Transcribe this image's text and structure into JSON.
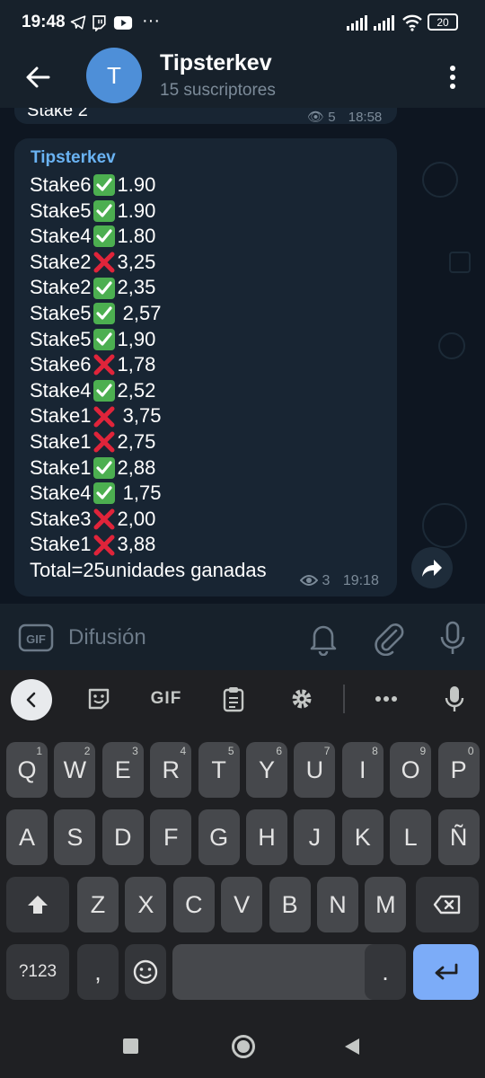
{
  "status_bar": {
    "time": "19:48",
    "battery": "20"
  },
  "header": {
    "avatar_letter": "T",
    "title": "Tipsterkev",
    "subtitle": "15 suscriptores"
  },
  "previous_message": {
    "text": "Stake 2",
    "views": "5",
    "time": "18:58"
  },
  "message": {
    "sender": "Tipsterkev",
    "lines": [
      {
        "label": "Stake6",
        "result": "check",
        "odds": "1.90"
      },
      {
        "label": "Stake5",
        "result": "check",
        "odds": "1.90"
      },
      {
        "label": "Stake4",
        "result": "check",
        "odds": "1.80"
      },
      {
        "label": "Stake2",
        "result": "cross",
        "odds": "3,25"
      },
      {
        "label": "Stake2",
        "result": "check",
        "odds": "2,35"
      },
      {
        "label": "Stake5",
        "result": "check",
        "odds": " 2,57"
      },
      {
        "label": "Stake5",
        "result": "check",
        "odds": "1,90"
      },
      {
        "label": "Stake6",
        "result": "cross",
        "odds": "1,78"
      },
      {
        "label": "Stake4",
        "result": "check",
        "odds": "2,52"
      },
      {
        "label": "Stake1",
        "result": "cross",
        "odds": " 3,75"
      },
      {
        "label": "Stake1",
        "result": "cross",
        "odds": "2,75"
      },
      {
        "label": "Stake1",
        "result": "check",
        "odds": "2,88"
      },
      {
        "label": "Stake4",
        "result": "check",
        "odds": " 1,75"
      },
      {
        "label": "Stake3",
        "result": "cross",
        "odds": "2,00"
      },
      {
        "label": "Stake1",
        "result": "cross",
        "odds": "3,88"
      }
    ],
    "total": "Total=25unidades ganadas",
    "views": "3",
    "time": "19:18"
  },
  "input_bar": {
    "placeholder": "Difusión"
  },
  "keyboard": {
    "toolbar": {
      "gif_label": "GIF"
    },
    "row1": [
      {
        "key": "Q",
        "hint": "1"
      },
      {
        "key": "W",
        "hint": "2"
      },
      {
        "key": "E",
        "hint": "3"
      },
      {
        "key": "R",
        "hint": "4"
      },
      {
        "key": "T",
        "hint": "5"
      },
      {
        "key": "Y",
        "hint": "6"
      },
      {
        "key": "U",
        "hint": "7"
      },
      {
        "key": "I",
        "hint": "8"
      },
      {
        "key": "O",
        "hint": "9"
      },
      {
        "key": "P",
        "hint": "0"
      }
    ],
    "row2": [
      "A",
      "S",
      "D",
      "F",
      "G",
      "H",
      "J",
      "K",
      "L",
      "Ñ"
    ],
    "row3": [
      "Z",
      "X",
      "C",
      "V",
      "B",
      "N",
      "M"
    ],
    "symbols_label": "?123",
    "comma": ",",
    "period": "."
  },
  "icons": {
    "check": "white-heavy-check-mark-icon",
    "cross": "cross-mark-icon"
  },
  "colors": {
    "accent": "#6ab3f3",
    "check_green": "#4caf50",
    "cross_red": "#e0243a",
    "enter_key": "#7cacf8"
  }
}
